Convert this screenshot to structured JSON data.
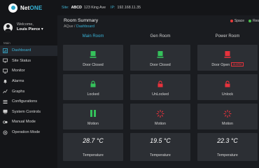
{
  "app": {
    "brand_prefix": "Net",
    "brand_suffix": "ONE"
  },
  "site": {
    "label": "Site:",
    "name": "ABCD",
    "address": "123 King Ave",
    "ip_label": "IP:",
    "ip": "192.168.11.35"
  },
  "user": {
    "welcome": "Welcome,",
    "name": "Louis Pierce ▾"
  },
  "menu": {
    "section_label": "Main",
    "items": [
      {
        "label": "Dashboard",
        "icon": "dashboard-icon",
        "active": true
      },
      {
        "label": "Site Status",
        "icon": "site-status-icon"
      },
      {
        "label": "Monitor",
        "icon": "monitor-icon"
      },
      {
        "label": "Alarms",
        "icon": "bell-icon"
      },
      {
        "label": "Graphs",
        "icon": "graph-icon"
      },
      {
        "label": "Configurations",
        "icon": "config-icon"
      },
      {
        "label": "System Controls",
        "icon": "system-controls-icon"
      },
      {
        "label": "Manual Mode",
        "icon": "manual-mode-icon"
      },
      {
        "label": "Operation Mode",
        "icon": "operation-mode-icon"
      }
    ]
  },
  "summary": {
    "title": "Room Summary",
    "breadcrumb_root": "AQue",
    "breadcrumb_sep": "/",
    "breadcrumb_current": "Dashboard",
    "legend": [
      {
        "label": "Space",
        "color": "#e83a3a"
      },
      {
        "label": "Res",
        "color": "#4ac24a"
      }
    ]
  },
  "rooms": [
    {
      "name": "Main Room",
      "door": "Door Closed",
      "door_alarm": "",
      "lock": "Locked",
      "motion": "Motion",
      "temperature": "28.7 °C",
      "temperature_label": "Temperature"
    },
    {
      "name": "Gen Room",
      "door": "Door Closed",
      "door_alarm": "",
      "lock": "UnLocked",
      "motion": "Motion",
      "temperature": "19.5 °C",
      "temperature_label": "Temperature"
    },
    {
      "name": "Power Room",
      "door": "Door Open",
      "door_alarm": "ALARM",
      "lock": "Unlock",
      "motion": "Motion",
      "temperature": "22.3 °C",
      "temperature_label": "Temperature"
    }
  ],
  "colors": {
    "accent": "#3ab4d8",
    "ok": "#35c25b",
    "alert": "#e8323c"
  }
}
